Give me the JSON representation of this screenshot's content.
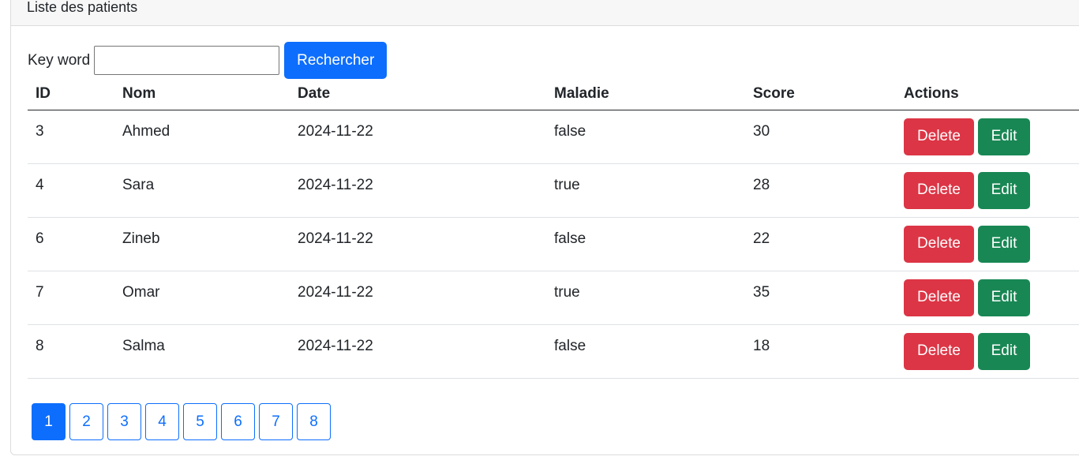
{
  "card": {
    "title": "Liste des patients"
  },
  "search": {
    "label": "Key word",
    "value": "",
    "placeholder": "",
    "button": "Rechercher"
  },
  "table": {
    "headers": [
      "ID",
      "Nom",
      "Date",
      "Maladie",
      "Score",
      "Actions"
    ],
    "rows": [
      {
        "id": "3",
        "nom": "Ahmed",
        "date": "2024-11-22",
        "maladie": "false",
        "score": "30"
      },
      {
        "id": "4",
        "nom": "Sara",
        "date": "2024-11-22",
        "maladie": "true",
        "score": "28"
      },
      {
        "id": "6",
        "nom": "Zineb",
        "date": "2024-11-22",
        "maladie": "false",
        "score": "22"
      },
      {
        "id": "7",
        "nom": "Omar",
        "date": "2024-11-22",
        "maladie": "true",
        "score": "35"
      },
      {
        "id": "8",
        "nom": "Salma",
        "date": "2024-11-22",
        "maladie": "false",
        "score": "18"
      }
    ],
    "delete_label": "Delete",
    "edit_label": "Edit"
  },
  "pagination": {
    "pages": [
      "1",
      "2",
      "3",
      "4",
      "5",
      "6",
      "7",
      "8"
    ],
    "current": "1"
  },
  "colors": {
    "primary": "#0d6efd",
    "danger": "#dc3545",
    "success": "#198754"
  }
}
